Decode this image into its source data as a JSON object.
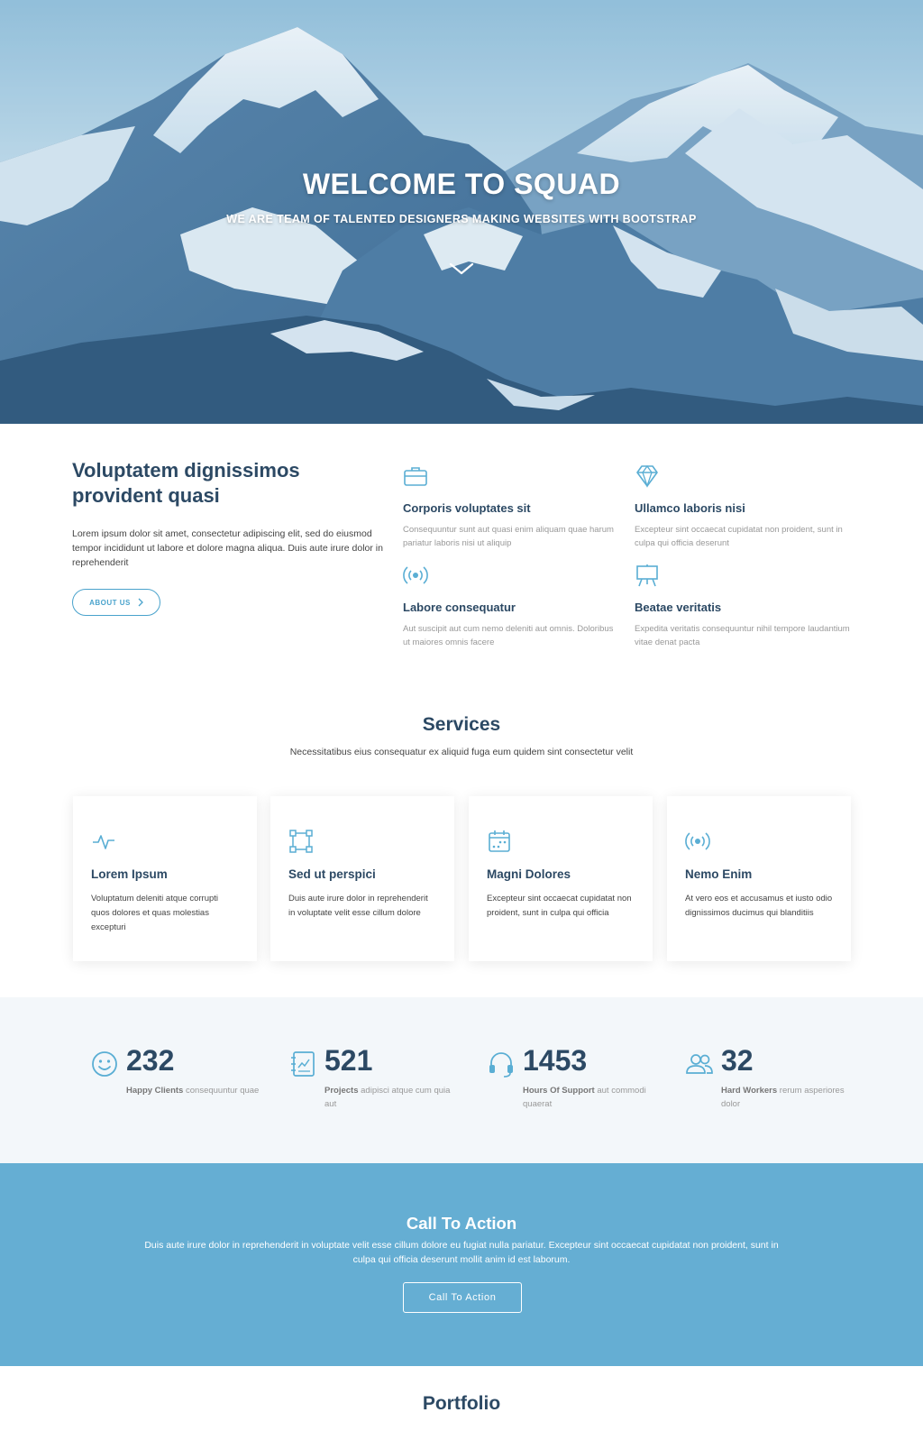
{
  "hero": {
    "title": "WELCOME TO SQUAD",
    "subtitle": "WE ARE TEAM OF TALENTED DESIGNERS MAKING WEBSITES WITH BOOTSTRAP"
  },
  "about": {
    "title": "Voluptatem dignissimos provident quasi",
    "text": "Lorem ipsum dolor sit amet, consectetur adipiscing elit, sed do eiusmod tempor incididunt ut labore et dolore magna aliqua. Duis aute irure dolor in reprehenderit",
    "button_label": "ABOUT US",
    "features": [
      {
        "icon": "briefcase-icon",
        "title": "Corporis voluptates sit",
        "text": "Consequuntur sunt aut quasi enim aliquam quae harum pariatur laboris nisi ut aliquip"
      },
      {
        "icon": "gem-icon",
        "title": "Ullamco laboris nisi",
        "text": "Excepteur sint occaecat cupidatat non proident, sunt in culpa qui officia deserunt"
      },
      {
        "icon": "broadcast-icon",
        "title": "Labore consequatur",
        "text": "Aut suscipit aut cum nemo deleniti aut omnis. Doloribus ut maiores omnis facere"
      },
      {
        "icon": "easel-icon",
        "title": "Beatae veritatis",
        "text": "Expedita veritatis consequuntur nihil tempore laudantium vitae denat pacta"
      }
    ]
  },
  "services": {
    "title": "Services",
    "subtitle": "Necessitatibus eius consequatur ex aliquid fuga eum quidem sint consectetur velit",
    "cards": [
      {
        "icon": "activity-icon",
        "title": "Lorem Ipsum",
        "text": "Voluptatum deleniti atque corrupti quos dolores et quas molestias excepturi"
      },
      {
        "icon": "bounding-box-icon",
        "title": "Sed ut perspici",
        "text": "Duis aute irure dolor in reprehenderit in voluptate velit esse cillum dolore"
      },
      {
        "icon": "calendar-icon",
        "title": "Magni Dolores",
        "text": "Excepteur sint occaecat cupidatat non proident, sunt in culpa qui officia"
      },
      {
        "icon": "broadcast-icon",
        "title": "Nemo Enim",
        "text": "At vero eos et accusamus et iusto odio dignissimos ducimus qui blanditiis"
      }
    ]
  },
  "counts": [
    {
      "icon": "smile-icon",
      "number": "232",
      "label": "Happy Clients",
      "text": " consequuntur quae"
    },
    {
      "icon": "journal-icon",
      "number": "521",
      "label": "Projects",
      "text": " adipisci atque cum quia aut"
    },
    {
      "icon": "headset-icon",
      "number": "1453",
      "label": "Hours Of Support",
      "text": " aut commodi quaerat"
    },
    {
      "icon": "people-icon",
      "number": "32",
      "label": "Hard Workers",
      "text": " rerum asperiores dolor"
    }
  ],
  "cta": {
    "title": "Call To Action",
    "text": "Duis aute irure dolor in reprehenderit in voluptate velit esse cillum dolore eu fugiat nulla pariatur. Excepteur sint occaecat cupidatat non proident, sunt in culpa qui officia deserunt mollit anim id est laborum.",
    "button_label": "Call To Action"
  },
  "portfolio": {
    "title": "Portfolio"
  },
  "colors": {
    "accent": "#5aaed4",
    "heading": "#2c4964",
    "cta_background": "#65aed3",
    "counts_background": "#f3f7fa"
  }
}
